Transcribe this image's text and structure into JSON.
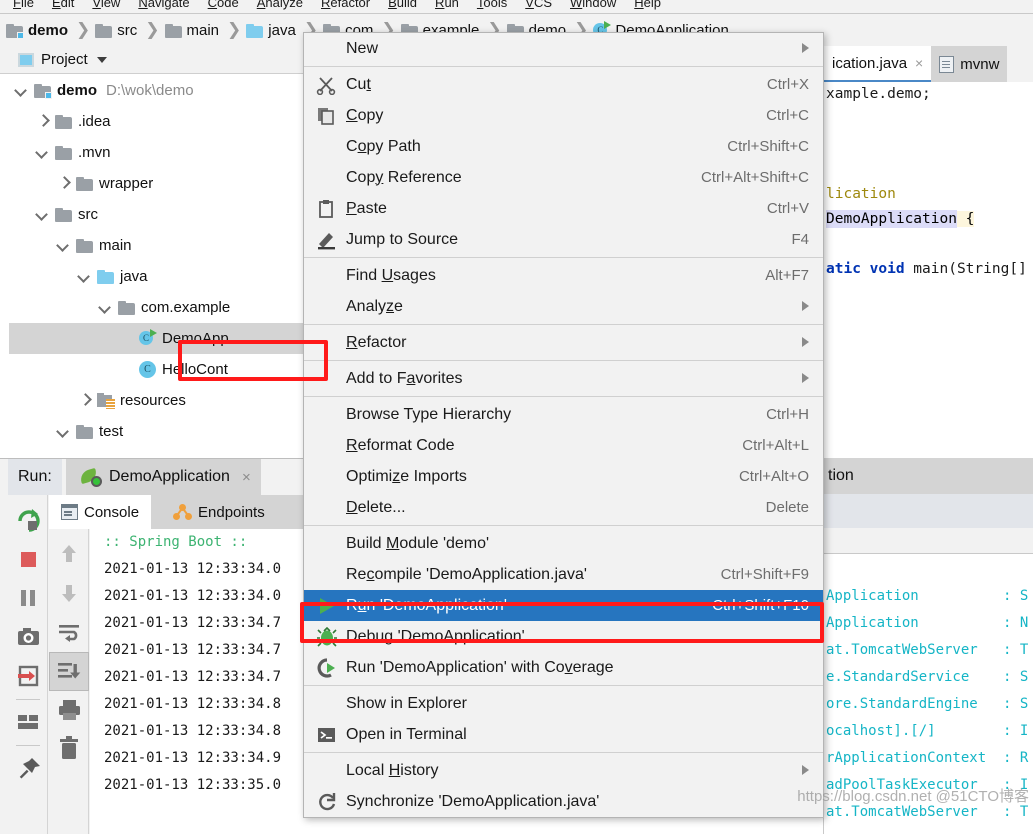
{
  "menubar": {
    "items": [
      "File",
      "Edit",
      "View",
      "Navigate",
      "Code",
      "Analyze",
      "Refactor",
      "Build",
      "Run",
      "Tools",
      "VCS",
      "Window",
      "Help"
    ]
  },
  "breadcrumb": {
    "items": [
      {
        "label": "demo",
        "icon": "module-folder-icon",
        "bold": true
      },
      {
        "label": "src",
        "icon": "folder-icon",
        "bold": false
      },
      {
        "label": "main",
        "icon": "folder-icon",
        "bold": false
      },
      {
        "label": "java",
        "icon": "source-folder-icon",
        "bold": false
      },
      {
        "label": "com",
        "icon": "folder-icon",
        "bold": false
      },
      {
        "label": "example",
        "icon": "folder-icon",
        "bold": false
      },
      {
        "label": "demo",
        "icon": "folder-icon",
        "bold": false
      },
      {
        "label": "DemoApplication",
        "icon": "runnable-class-icon",
        "bold": false
      }
    ]
  },
  "project_panel": {
    "title": "Project",
    "tree": [
      {
        "label": "demo",
        "path": "D:\\wok\\demo",
        "indent": 0,
        "arrow": "down",
        "icon": "module-folder-icon",
        "bold": true,
        "selected": false
      },
      {
        "label": ".idea",
        "path": "",
        "indent": 1,
        "arrow": "right",
        "icon": "folder-icon",
        "bold": false,
        "selected": false
      },
      {
        "label": ".mvn",
        "path": "",
        "indent": 1,
        "arrow": "down",
        "icon": "folder-icon",
        "bold": false,
        "selected": false
      },
      {
        "label": "wrapper",
        "path": "",
        "indent": 2,
        "arrow": "right",
        "icon": "folder-icon",
        "bold": false,
        "selected": false
      },
      {
        "label": "src",
        "path": "",
        "indent": 1,
        "arrow": "down",
        "icon": "folder-icon",
        "bold": false,
        "selected": false
      },
      {
        "label": "main",
        "path": "",
        "indent": 2,
        "arrow": "down",
        "icon": "folder-icon",
        "bold": false,
        "selected": false
      },
      {
        "label": "java",
        "path": "",
        "indent": 3,
        "arrow": "down",
        "icon": "source-folder-icon",
        "bold": false,
        "selected": false
      },
      {
        "label": "com.example",
        "path": "",
        "indent": 4,
        "arrow": "down",
        "icon": "package-folder-icon",
        "bold": false,
        "selected": false
      },
      {
        "label": "DemoApp",
        "path": "",
        "indent": 5,
        "arrow": "none",
        "icon": "runnable-class-icon",
        "bold": false,
        "selected": true
      },
      {
        "label": "HelloCont",
        "path": "",
        "indent": 5,
        "arrow": "none",
        "icon": "class-icon",
        "bold": false,
        "selected": false
      },
      {
        "label": "resources",
        "path": "",
        "indent": 3,
        "arrow": "right",
        "icon": "resources-folder-icon",
        "bold": false,
        "selected": false
      },
      {
        "label": "test",
        "path": "",
        "indent": 2,
        "arrow": "down",
        "icon": "folder-icon",
        "bold": false,
        "selected": false
      }
    ]
  },
  "context_menu": {
    "items": [
      {
        "label": "New",
        "underline_at": -1,
        "shortcut": "",
        "submenu": true,
        "icon": "",
        "selected": false,
        "sep_after": true
      },
      {
        "label": "Cut",
        "underline_at": 2,
        "shortcut": "Ctrl+X",
        "submenu": false,
        "icon": "scissors-icon",
        "selected": false,
        "sep_after": false
      },
      {
        "label": "Copy",
        "underline_at": 0,
        "shortcut": "Ctrl+C",
        "submenu": false,
        "icon": "copy-icon",
        "selected": false,
        "sep_after": false
      },
      {
        "label": "Copy Path",
        "underline_at": 1,
        "shortcut": "Ctrl+Shift+C",
        "submenu": false,
        "icon": "",
        "selected": false,
        "sep_after": false
      },
      {
        "label": "Copy Reference",
        "underline_at": 3,
        "shortcut": "Ctrl+Alt+Shift+C",
        "submenu": false,
        "icon": "",
        "selected": false,
        "sep_after": false
      },
      {
        "label": "Paste",
        "underline_at": 0,
        "shortcut": "Ctrl+V",
        "submenu": false,
        "icon": "clipboard-icon",
        "selected": false,
        "sep_after": false
      },
      {
        "label": "Jump to Source",
        "underline_at": -1,
        "shortcut": "F4",
        "submenu": false,
        "icon": "pencil-icon",
        "selected": false,
        "sep_after": true
      },
      {
        "label": "Find Usages",
        "underline_at": 5,
        "shortcut": "Alt+F7",
        "submenu": false,
        "icon": "",
        "selected": false,
        "sep_after": false
      },
      {
        "label": "Analyze",
        "underline_at": 5,
        "shortcut": "",
        "submenu": true,
        "icon": "",
        "selected": false,
        "sep_after": true
      },
      {
        "label": "Refactor",
        "underline_at": 0,
        "shortcut": "",
        "submenu": true,
        "icon": "",
        "selected": false,
        "sep_after": true
      },
      {
        "label": "Add to Favorites",
        "underline_at": 8,
        "shortcut": "",
        "submenu": true,
        "icon": "",
        "selected": false,
        "sep_after": true
      },
      {
        "label": "Browse Type Hierarchy",
        "underline_at": -1,
        "shortcut": "Ctrl+H",
        "submenu": false,
        "icon": "",
        "selected": false,
        "sep_after": false
      },
      {
        "label": "Reformat Code",
        "underline_at": 0,
        "shortcut": "Ctrl+Alt+L",
        "submenu": false,
        "icon": "",
        "selected": false,
        "sep_after": false
      },
      {
        "label": "Optimize Imports",
        "underline_at": 6,
        "shortcut": "Ctrl+Alt+O",
        "submenu": false,
        "icon": "",
        "selected": false,
        "sep_after": false
      },
      {
        "label": "Delete...",
        "underline_at": 0,
        "shortcut": "Delete",
        "submenu": false,
        "icon": "",
        "selected": false,
        "sep_after": true
      },
      {
        "label": "Build Module 'demo'",
        "underline_at": 6,
        "shortcut": "",
        "submenu": false,
        "icon": "",
        "selected": false,
        "sep_after": false
      },
      {
        "label": "Recompile 'DemoApplication.java'",
        "underline_at": 2,
        "shortcut": "Ctrl+Shift+F9",
        "submenu": false,
        "icon": "",
        "selected": false,
        "sep_after": false
      },
      {
        "label": "Run 'DemoApplication'",
        "underline_at": 1,
        "shortcut": "Ctrl+Shift+F10",
        "submenu": false,
        "icon": "run-green-triangle-icon",
        "selected": true,
        "sep_after": false
      },
      {
        "label": "Debug 'DemoApplication'",
        "underline_at": 0,
        "shortcut": "",
        "submenu": false,
        "icon": "debug-bug-icon",
        "selected": false,
        "sep_after": false
      },
      {
        "label": "Run 'DemoApplication' with Coverage",
        "underline_at": 29,
        "shortcut": "",
        "submenu": false,
        "icon": "coverage-icon",
        "selected": false,
        "sep_after": true
      },
      {
        "label": "Show in Explorer",
        "underline_at": -1,
        "shortcut": "",
        "submenu": false,
        "icon": "",
        "selected": false,
        "sep_after": false
      },
      {
        "label": "Open in Terminal",
        "underline_at": -1,
        "shortcut": "",
        "submenu": false,
        "icon": "terminal-icon",
        "selected": false,
        "sep_after": true
      },
      {
        "label": "Local History",
        "underline_at": 6,
        "shortcut": "",
        "submenu": true,
        "icon": "",
        "selected": false,
        "sep_after": false
      },
      {
        "label": "Synchronize 'DemoApplication.java'",
        "underline_at": -1,
        "shortcut": "",
        "submenu": false,
        "icon": "refresh-icon",
        "selected": false,
        "sep_after": false
      }
    ]
  },
  "run_window": {
    "label": "Run:",
    "tab_name": "DemoApplication",
    "tab_close": "×",
    "subtabs": [
      {
        "label": "Console",
        "active": true
      },
      {
        "label": "Endpoints",
        "active": false
      }
    ],
    "sidebar_icons": [
      "rerun-icon",
      "stop-icon",
      "pause-icon",
      "camera-icon",
      "export-icon",
      "layout-icon",
      "pin-icon"
    ],
    "console_toolbar_icons": [
      "scroll-up-icon",
      "scroll-down-icon",
      "soft-wrap-icon",
      "scroll-to-end-icon",
      "print-icon",
      "trash-icon"
    ],
    "console_lines": [
      ":: Spring Boot ::",
      "2021-01-13 12:33:34.0",
      "2021-01-13 12:33:34.0",
      "2021-01-13 12:33:34.7",
      "2021-01-13 12:33:34.7",
      "2021-01-13 12:33:34.7",
      "2021-01-13 12:33:34.8",
      "2021-01-13 12:33:34.8",
      "2021-01-13 12:33:34.9",
      "2021-01-13 12:33:35.0"
    ]
  },
  "editor": {
    "tabs": [
      {
        "label": "ication.java",
        "active": true,
        "close": "×"
      },
      {
        "label": "mvnw",
        "active": false,
        "close": ""
      }
    ],
    "code_lines": [
      "xample.demo;",
      "",
      "",
      "",
      "lication",
      "DemoApplication {",
      "",
      "atic void main(String[]"
    ]
  },
  "right_log": {
    "tab_label": "tion",
    "lines": [
      "Application          : S",
      "Application          : N",
      "at.TomcatWebServer   : T",
      "e.StandardService    : S",
      "ore.StandardEngine   : S",
      "ocalhost].[/]        : I",
      "rApplicationContext  : R",
      "adPoolTaskExecutor   : I",
      "at.TomcatWebServer   : T"
    ]
  },
  "watermark": {
    "text": "https://blog.csdn.net @51CTO博客"
  },
  "colors": {
    "menu_selection": "#2675bf",
    "highlight_box": "#ff1a1a",
    "spring_green": "#6db33f",
    "console_cyan": "#15b5c6",
    "accent_blue": "#4a88c7"
  }
}
